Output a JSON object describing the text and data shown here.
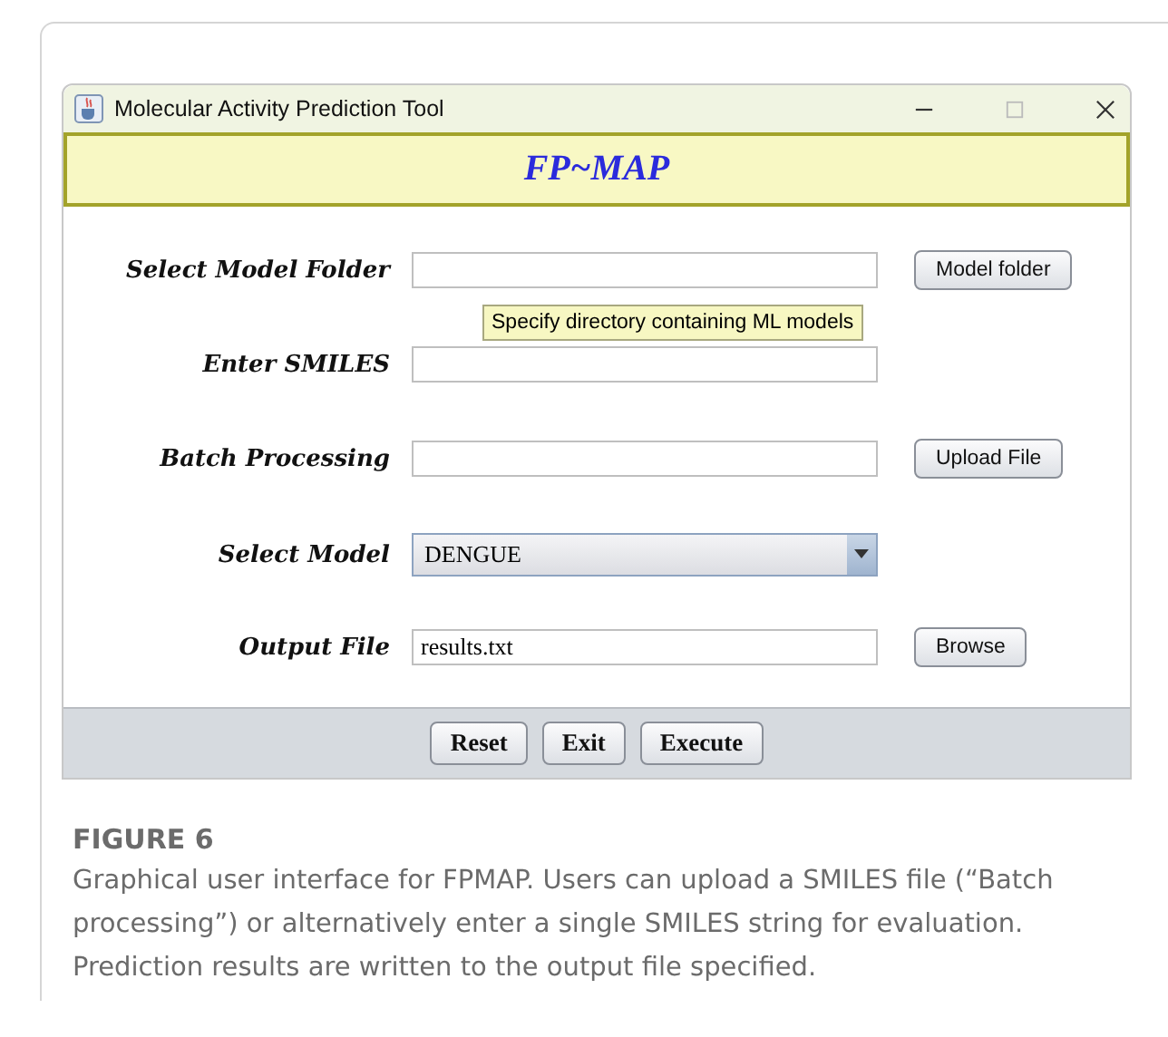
{
  "window": {
    "title": "Molecular Activity Prediction Tool"
  },
  "banner": {
    "title": "FP~MAP"
  },
  "rows": [
    {
      "kind": "field",
      "label": "Select Model Folder",
      "button": "Model folder"
    },
    {
      "kind": "field",
      "label": "Enter SMILES"
    },
    {
      "kind": "field",
      "label": "Batch Processing",
      "button": "Upload File"
    },
    {
      "kind": "dropdown",
      "label": "Select Model",
      "value": "DENGUE"
    },
    {
      "kind": "field",
      "label": "Output File",
      "value": "results.txt",
      "button": "Browse"
    }
  ],
  "tooltip": {
    "text": "Specify directory containing ML models"
  },
  "footer_buttons": [
    "Reset",
    "Exit",
    "Execute"
  ],
  "caption": {
    "label": "FIGURE 6",
    "text": "Graphical user interface for FPMAP. Users can upload a SMILES file (“Batch processing”) or alternatively enter a single SMILES string for evaluation. Prediction results are written to the output file specified."
  }
}
